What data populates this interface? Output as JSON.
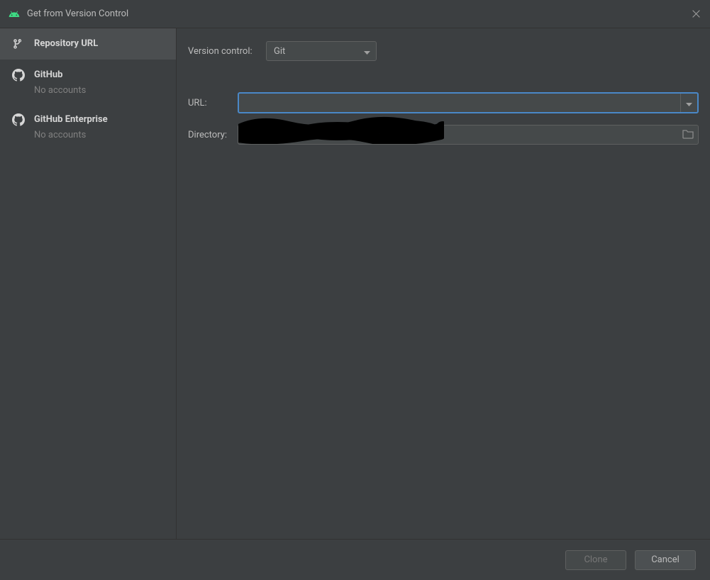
{
  "titlebar": {
    "title": "Get from Version Control"
  },
  "sidebar": {
    "items": [
      {
        "label": "Repository URL",
        "sublabel": ""
      },
      {
        "label": "GitHub",
        "sublabel": "No accounts"
      },
      {
        "label": "GitHub Enterprise",
        "sublabel": "No accounts"
      }
    ]
  },
  "form": {
    "version_control_label": "Version control:",
    "version_control_value": "Git",
    "url_label": "URL:",
    "url_value": "",
    "directory_label": "Directory:",
    "directory_value": ""
  },
  "footer": {
    "clone_label": "Clone",
    "cancel_label": "Cancel"
  }
}
